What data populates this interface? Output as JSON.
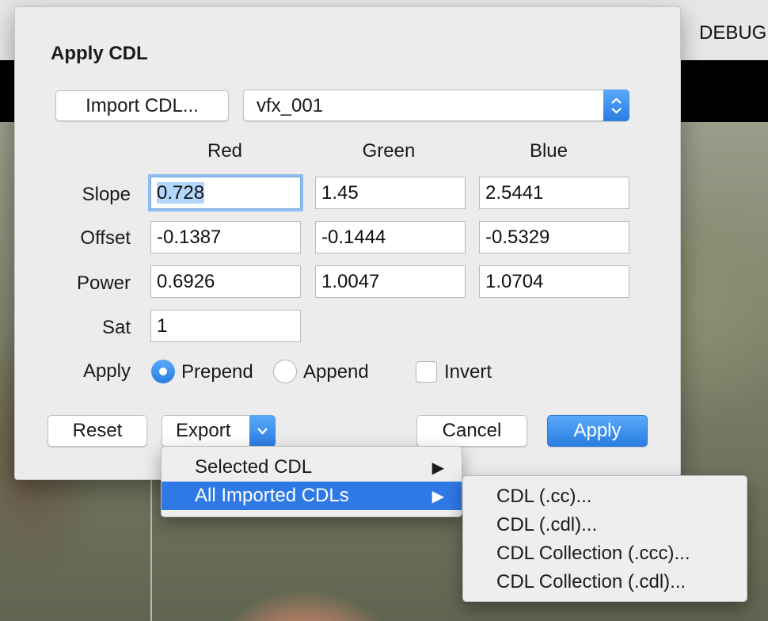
{
  "app": {
    "topbar_label": "DEBUG"
  },
  "dialog": {
    "title": "Apply CDL",
    "import_button": "Import CDL...",
    "cdl_select": {
      "selected": "vfx_001"
    },
    "columns": [
      "Red",
      "Green",
      "Blue"
    ],
    "rows": [
      {
        "label": "Slope",
        "values": [
          "0.728",
          "1.45",
          "2.5441"
        ]
      },
      {
        "label": "Offset",
        "values": [
          "-0.1387",
          "-0.1444",
          "-0.5329"
        ]
      },
      {
        "label": "Power",
        "values": [
          "0.6926",
          "1.0047",
          "1.0704"
        ]
      },
      {
        "label": "Sat",
        "values": [
          "1"
        ]
      }
    ],
    "apply_mode": {
      "label": "Apply",
      "options": [
        "Prepend",
        "Append"
      ],
      "selected": "Prepend",
      "invert_label": "Invert",
      "invert_checked": false
    },
    "buttons": {
      "reset": "Reset",
      "export": "Export",
      "cancel": "Cancel",
      "apply": "Apply"
    }
  },
  "export_menu": {
    "items": [
      {
        "label": "Selected CDL",
        "has_submenu": true,
        "highlighted": false
      },
      {
        "label": "All Imported CDLs",
        "has_submenu": true,
        "highlighted": true
      }
    ],
    "arrow_glyph": "▶"
  },
  "submenu": {
    "items": [
      "CDL (.cc)...",
      "CDL (.cdl)...",
      "CDL Collection (.ccc)...",
      "CDL Collection (.cdl)..."
    ]
  },
  "colors": {
    "accent": "#2f79e6",
    "selection": "#b3d6fd"
  }
}
